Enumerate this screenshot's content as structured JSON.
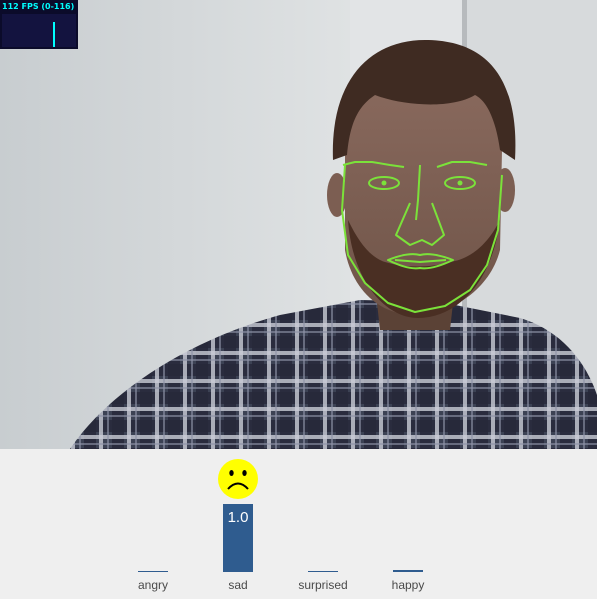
{
  "stats": {
    "fps_label": "112 FPS (0-116)",
    "fps_value": 112,
    "fps_max": 116
  },
  "video": {
    "tracker_color": "#7be23a"
  },
  "emotions": {
    "bar_color": "#2f5c8f",
    "items": [
      {
        "label": "angry",
        "value": 0.0,
        "value_label": ""
      },
      {
        "label": "sad",
        "value": 1.0,
        "value_label": "1.0",
        "emoji": "sad-face-icon"
      },
      {
        "label": "surprised",
        "value": 0.0,
        "value_label": ""
      },
      {
        "label": "happy",
        "value": 0.03,
        "value_label": ""
      }
    ]
  }
}
